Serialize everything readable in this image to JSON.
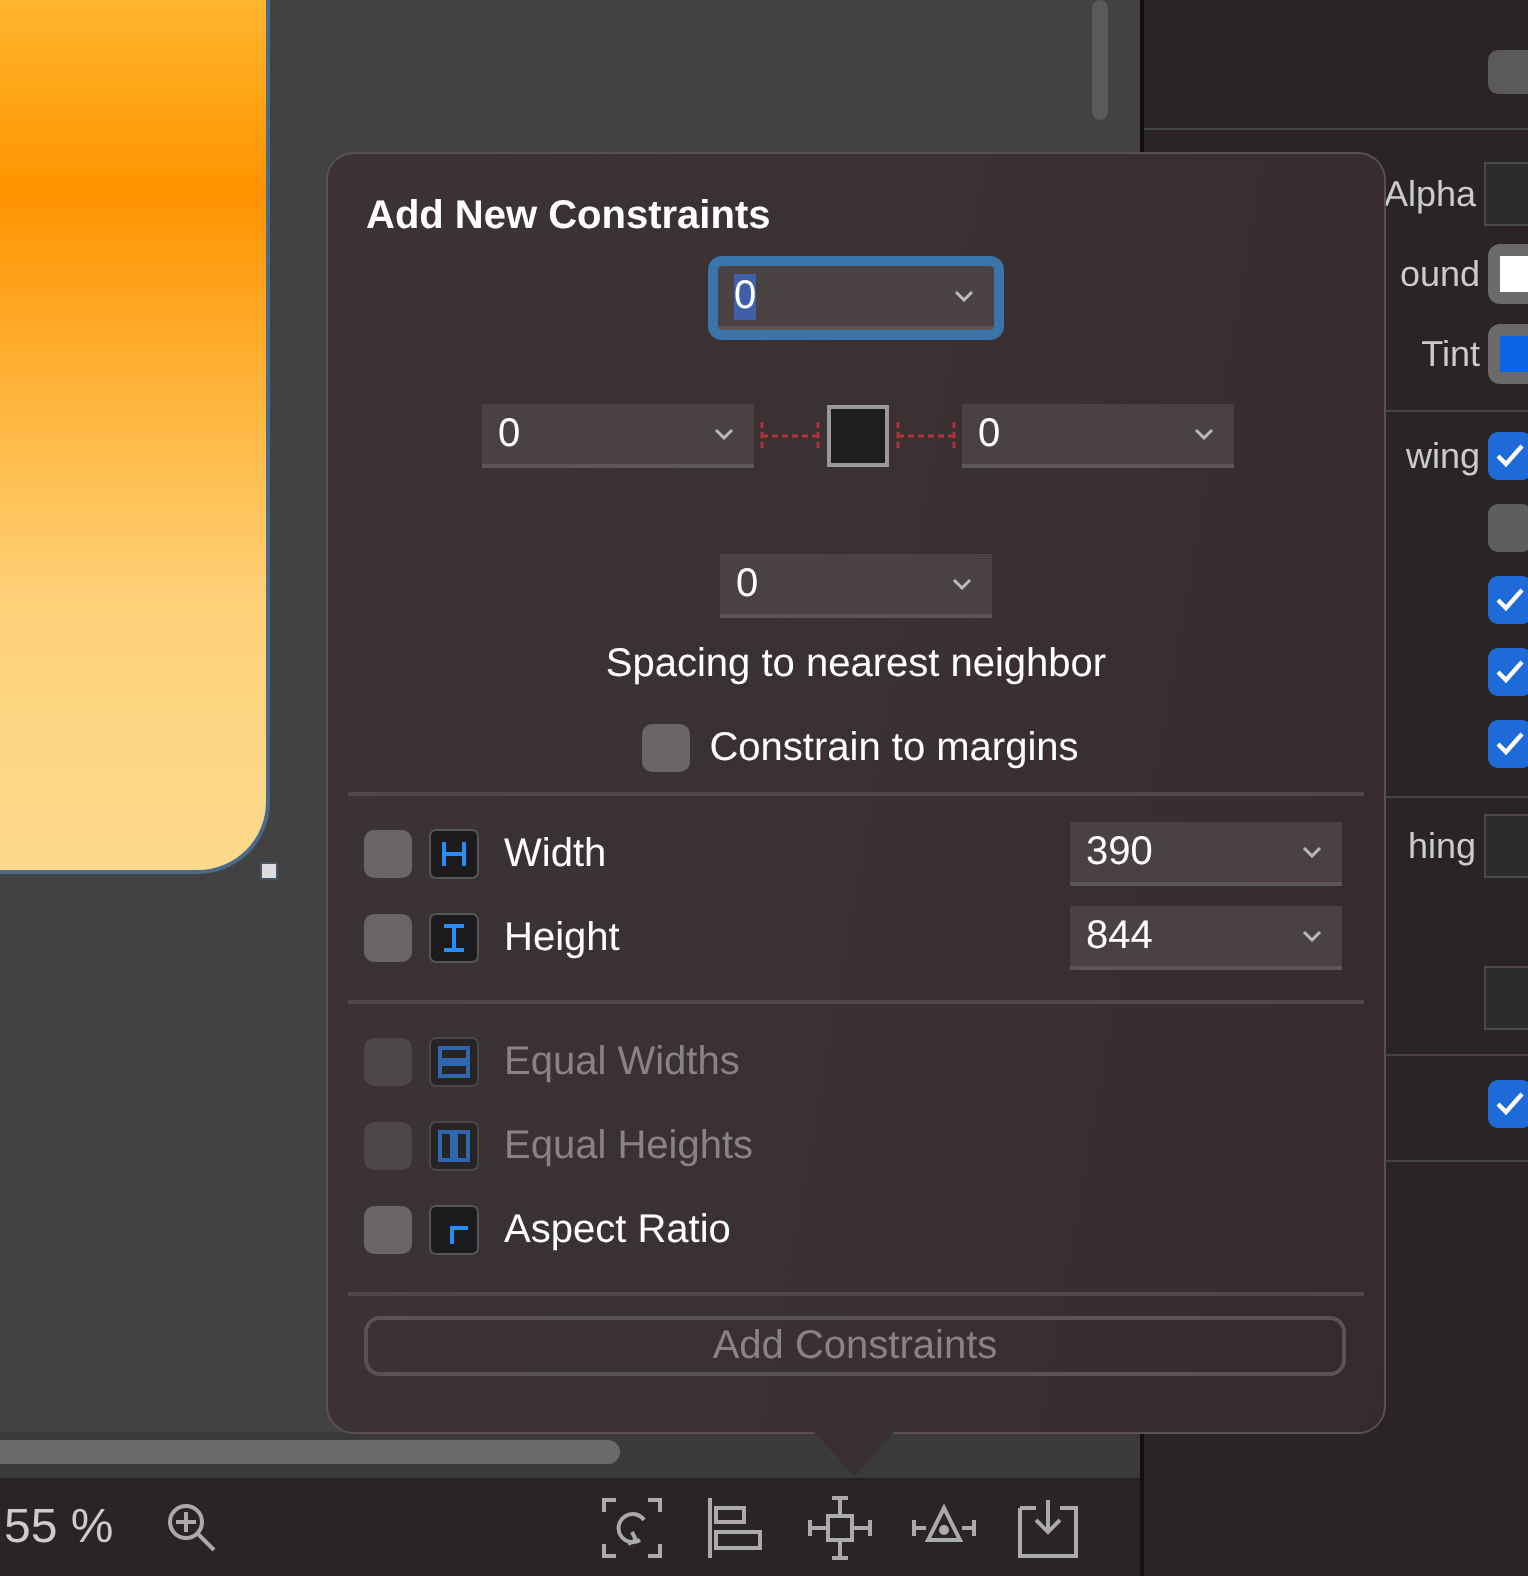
{
  "canvas": {
    "zoom_label": "55 %"
  },
  "constraints_popover": {
    "title": "Add New Constraints",
    "spacing": {
      "top": {
        "value": "0",
        "focused": true
      },
      "left": {
        "value": "0",
        "focused": false
      },
      "right": {
        "value": "0",
        "focused": false
      },
      "bottom": {
        "value": "0",
        "focused": false
      }
    },
    "spacing_caption": "Spacing to nearest neighbor",
    "constrain_to_margins": {
      "label": "Constrain to margins",
      "checked": false
    },
    "size_rows": [
      {
        "kind": "width",
        "label": "Width",
        "checked": false,
        "disabled": false,
        "value": "390"
      },
      {
        "kind": "height",
        "label": "Height",
        "checked": false,
        "disabled": false,
        "value": "844"
      }
    ],
    "relation_rows": [
      {
        "kind": "equal_widths",
        "label": "Equal Widths",
        "checked": false,
        "disabled": true
      },
      {
        "kind": "equal_heights",
        "label": "Equal Heights",
        "checked": false,
        "disabled": true
      },
      {
        "kind": "aspect_ratio",
        "label": "Aspect Ratio",
        "checked": false,
        "disabled": false
      }
    ],
    "add_button": {
      "label": "Add Constraints",
      "disabled": true
    }
  },
  "inspector": {
    "sections": [
      {
        "rows": [
          {
            "kind": "button"
          }
        ]
      },
      {
        "rows": [
          {
            "kind": "field",
            "label": "Alpha"
          },
          {
            "kind": "swatch",
            "label": "ound",
            "color": "#ffffff"
          },
          {
            "kind": "swatch",
            "label": "Tint",
            "color": "#0a64e6"
          }
        ]
      },
      {
        "rows": [
          {
            "kind": "checkbox",
            "label": "wing",
            "checked": true
          },
          {
            "kind": "checkbox",
            "checked": false
          },
          {
            "kind": "checkbox",
            "checked": true
          },
          {
            "kind": "checkbox",
            "checked": true
          },
          {
            "kind": "checkbox",
            "checked": true
          }
        ]
      },
      {
        "rows": [
          {
            "kind": "field",
            "label": "hing"
          },
          {
            "kind": "field"
          }
        ]
      },
      {
        "rows": [
          {
            "kind": "checkbox",
            "checked": true
          }
        ]
      }
    ]
  }
}
